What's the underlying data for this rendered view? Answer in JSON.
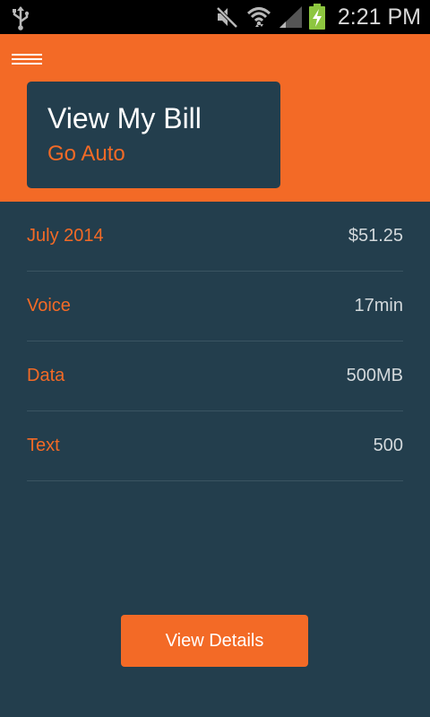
{
  "status_bar": {
    "time": "2:21 PM",
    "icons": [
      "usb-icon",
      "mute-icon",
      "wifi-icon",
      "signal-icon",
      "battery-charging-icon"
    ],
    "battery_color": "#8dc63f"
  },
  "header": {
    "menu_icon": "hamburger-menu-icon",
    "card": {
      "title": "View My Bill",
      "subtitle": "Go Auto"
    }
  },
  "bill": {
    "rows": [
      {
        "label": "July 2014",
        "value": "$51.25"
      },
      {
        "label": "Voice",
        "value": "17min"
      },
      {
        "label": "Data",
        "value": "500MB"
      },
      {
        "label": "Text",
        "value": "500"
      }
    ]
  },
  "actions": {
    "view_details_label": "View Details"
  },
  "colors": {
    "accent": "#f36a26",
    "background": "#233e4d",
    "divider": "#3a5462",
    "value_text": "#d3d9dc"
  }
}
